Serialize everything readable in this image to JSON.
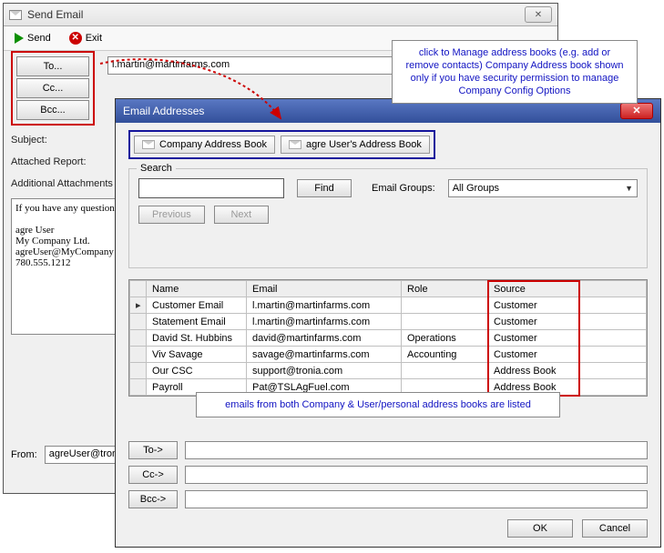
{
  "send_window": {
    "title": "Send Email",
    "send_label": "Send",
    "exit_label": "Exit",
    "to_btn": "To...",
    "cc_btn": "Cc...",
    "bcc_btn": "Bcc...",
    "to_value": "l.martin@martinfarms.com",
    "subject_label": "Subject:",
    "attached_label": "Attached Report:",
    "additional_label": "Additional Attachments",
    "body": "If you have any questions\n\nagre User\nMy Company Ltd.\nagreUser@MyCompany\n780.555.1212",
    "from_label": "From:",
    "from_value": "agreUser@tronia"
  },
  "addr_window": {
    "title": "Email Addresses",
    "tab1": "Company Address Book",
    "tab2": "agre User's Address Book",
    "search_legend": "Search",
    "search_value": "",
    "find_label": "Find",
    "email_groups_label": "Email Groups:",
    "email_groups_value": "All Groups",
    "previous_label": "Previous",
    "next_label": "Next",
    "columns": {
      "name": "Name",
      "email": "Email",
      "role": "Role",
      "source": "Source"
    },
    "rows": [
      {
        "name": "Customer Email",
        "email": "l.martin@martinfarms.com",
        "role": "",
        "source": "Customer"
      },
      {
        "name": "Statement Email",
        "email": "l.martin@martinfarms.com",
        "role": "",
        "source": "Customer"
      },
      {
        "name": "David St. Hubbins",
        "email": "david@martinfarms.com",
        "role": "Operations",
        "source": "Customer"
      },
      {
        "name": "Viv Savage",
        "email": "savage@martinfarms.com",
        "role": "Accounting",
        "source": "Customer"
      },
      {
        "name": "Our CSC",
        "email": "support@tronia.com",
        "role": "",
        "source": "Address Book"
      },
      {
        "name": "Payroll",
        "email": "Pat@TSLAgFuel.com",
        "role": "",
        "source": "Address Book"
      }
    ],
    "to_out": "To->",
    "cc_out": "Cc->",
    "bcc_out": "Bcc->",
    "ok_label": "OK",
    "cancel_label": "Cancel"
  },
  "callouts": {
    "top": "click to Manage address books\n(e.g. add or remove contacts)\nCompany Address book shown only if\nyou have security permission to\nmanage Company Config Options",
    "mid": "emails from both Company & User/personal address books are listed"
  }
}
